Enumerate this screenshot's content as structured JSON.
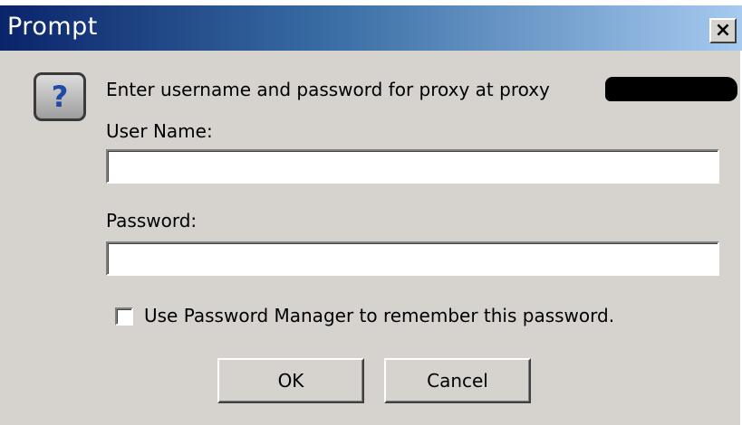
{
  "window": {
    "title": "Prompt",
    "close_glyph": "×"
  },
  "dialog": {
    "icon": "question-icon",
    "icon_glyph": "?",
    "message": "Enter username and password for proxy at proxy",
    "username_label": "User Name:",
    "username_value": "",
    "password_label": "Password:",
    "password_value": "",
    "remember_label": "Use Password Manager to remember this password.",
    "remember_checked": false
  },
  "buttons": {
    "ok_label": "OK",
    "cancel_label": "Cancel"
  },
  "colors": {
    "titlebar_start": "#0a246a",
    "titlebar_end": "#a6caf0",
    "dialog_bg": "#d6d3ce",
    "icon_question": "#1f4aa8"
  }
}
